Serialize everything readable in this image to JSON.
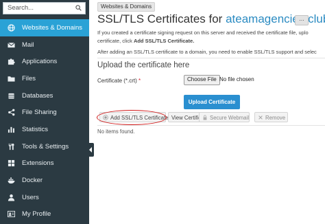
{
  "sidebar": {
    "search_placeholder": "Search...",
    "items": [
      {
        "label": "Websites & Domains",
        "icon": "globe-icon",
        "active": true
      },
      {
        "label": "Mail",
        "icon": "envelope-icon"
      },
      {
        "label": "Applications",
        "icon": "puzzle-icon"
      },
      {
        "label": "Files",
        "icon": "folder-icon"
      },
      {
        "label": "Databases",
        "icon": "database-icon"
      },
      {
        "label": "File Sharing",
        "icon": "share-icon"
      },
      {
        "label": "Statistics",
        "icon": "bar-chart-icon"
      },
      {
        "label": "Tools & Settings",
        "icon": "tools-icon"
      },
      {
        "label": "Extensions",
        "icon": "extensions-icon"
      },
      {
        "label": "Docker",
        "icon": "docker-icon"
      },
      {
        "label": "Users",
        "icon": "user-icon"
      },
      {
        "label": "My Profile",
        "icon": "profile-icon"
      }
    ]
  },
  "breadcrumb": {
    "label": "Websites & Domains"
  },
  "page": {
    "title_prefix": "SSL/TLS Certificates for ",
    "domain": "ateamagencies.club",
    "more_label": "..."
  },
  "intro": {
    "line1": "If you created a certificate signing request on this server and received the certificate file, uplo",
    "line2_prefix": "certificate, click ",
    "line2_bold": "Add SSL/TLS Certificate.",
    "line3": "After adding an SSL/TLS certificate to a domain, you need to enable SSL/TLS support and selec"
  },
  "upload": {
    "section_title": "Upload the certificate here",
    "field_label": "Certificate (*.crt)",
    "required_mark": "*",
    "choose_label": "Choose File",
    "file_status": "No file chosen",
    "upload_label": "Upload Certificate"
  },
  "toolbar": {
    "add_label": "Add SSL/TLS Certificate",
    "view_label": "View Certificates",
    "secure_label": "Secure Webmail",
    "remove_label": "Remove"
  },
  "list": {
    "empty_text": "No items found."
  },
  "colors": {
    "sidebar_bg": "#2b3a42",
    "active": "#2aa2d6",
    "link": "#2b8bc2",
    "primary_button": "#2a8fd0",
    "annotation": "#d01515"
  }
}
